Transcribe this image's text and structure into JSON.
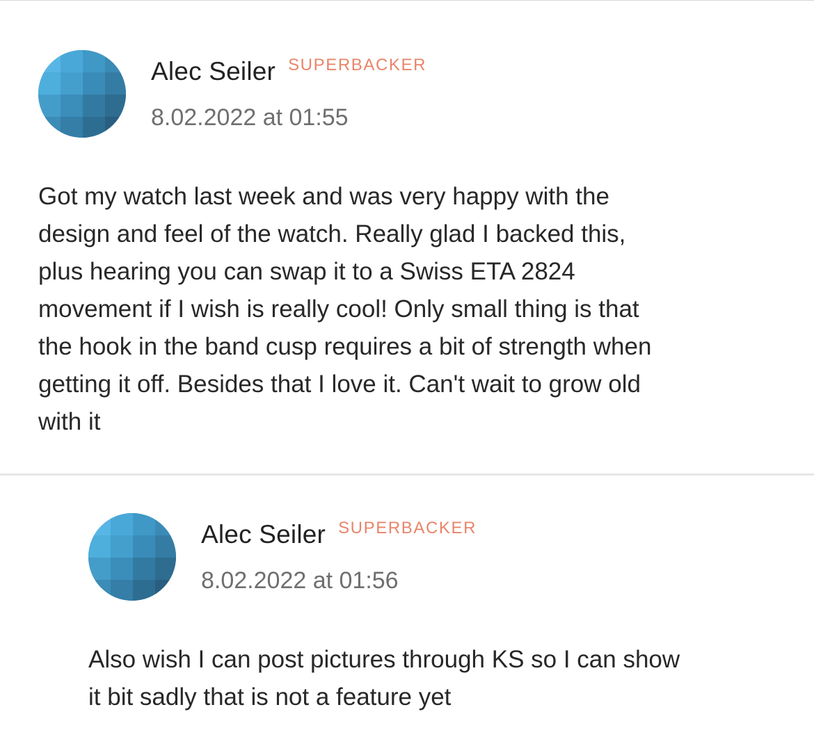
{
  "comments": [
    {
      "author": "Alec Seiler",
      "badge": "SUPERBACKER",
      "timestamp": "8.02.2022 at 01:55",
      "body": "Got my watch last week and was very happy with the\ndesign and feel of the watch. Really glad I backed this,\nplus hearing you can swap it to a Swiss ETA 2824\nmovement if I wish is really cool! Only small thing is that\nthe hook in the band cusp requires a bit of strength when\ngetting it off. Besides that I love it. Can't wait to grow old\nwith it",
      "avatar_icon": "avatar-icon"
    },
    {
      "author": "Alec Seiler",
      "badge": "SUPERBACKER",
      "timestamp": "8.02.2022 at 01:56",
      "body": "Also wish I can post pictures through KS so I can show\nit bit sadly that is not a feature yet",
      "avatar_icon": "avatar-icon"
    }
  ],
  "colors": {
    "badge": "#e8856a",
    "timestamp": "#6f6f6f",
    "avatar_light": "#4fb0e0",
    "avatar_dark": "#2a5f80"
  }
}
